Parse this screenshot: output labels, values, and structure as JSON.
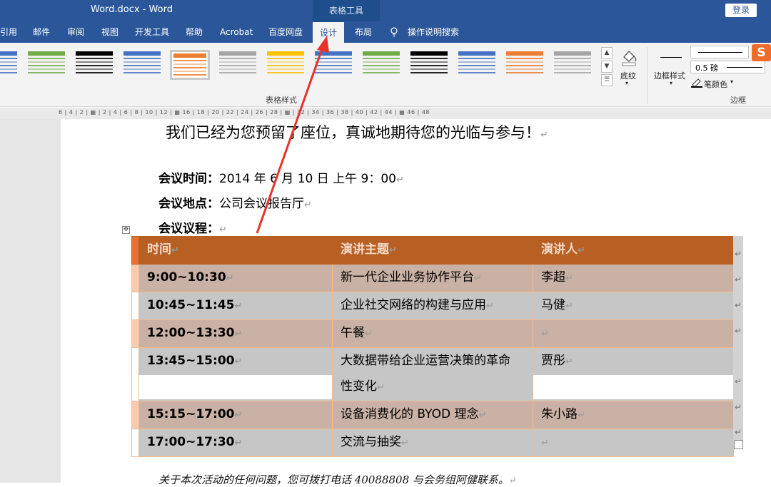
{
  "window": {
    "title": "Word.docx  -  Word",
    "context_tab": "表格工具",
    "login": "登录"
  },
  "tabs": [
    {
      "label": "引用"
    },
    {
      "label": "邮件"
    },
    {
      "label": "审阅"
    },
    {
      "label": "视图"
    },
    {
      "label": "开发工具"
    },
    {
      "label": "帮助"
    },
    {
      "label": "Acrobat"
    },
    {
      "label": "百度网盘"
    },
    {
      "label": "设计",
      "active": true
    },
    {
      "label": "布局"
    },
    {
      "label": "操作说明搜索"
    }
  ],
  "ribbon": {
    "group_table_styles": "表格样式",
    "shading": "底纹",
    "border_styles": "边框样式",
    "pen_weight": "0.5 磅",
    "pen_color": "笔颜色",
    "group_borders": "边框",
    "swatch_colors": [
      "#4472c4",
      "#70ad47",
      "#000000",
      "#4472c4",
      "#ed7d31",
      "#a5a5a5",
      "#ffc000",
      "#4472c4",
      "#70ad47",
      "#000000",
      "#4472c4",
      "#ed7d31",
      "#a5a5a5"
    ]
  },
  "ruler": {
    "text": "6 | 4 | 2 | ▦ | 2 | 4 | 6 | 8 | 10 | 12 | ▦ 16 | 18 | 20 | 22 | 24 | 26 | 28 | ▦ | 32 | 34 | 36 | 38 | 40 | 42 | 44 | ▦ 46 | 48"
  },
  "document": {
    "heading": "我们已经为您预留了座位，真诚地期待您的光临与参与！",
    "meeting_time_label": "会议时间：",
    "meeting_time_value": "2014 年 6 月 10 日  上午 9：00",
    "meeting_place_label": "会议地点：",
    "meeting_place_value": "公司会议报告厅",
    "agenda_label": "会议议程：",
    "footer": "关于本次活动的任何问题，您可拨打电话 40088808 与会务组阿健联系。",
    "para_mark": "↵"
  },
  "table": {
    "headers": [
      "时间",
      "演讲主题",
      "演讲人"
    ],
    "rows": [
      {
        "time": "9:00~10:30",
        "topic": "新一代企业业务协作平台",
        "speaker": "李超"
      },
      {
        "time": "10:45~11:45",
        "topic": "企业社交网络的构建与应用",
        "speaker": "马健"
      },
      {
        "time": "12:00~13:30",
        "topic": "午餐",
        "speaker": ""
      },
      {
        "time": "13:45~15:00",
        "topic_line1": "大数据带给企业运营决策的革命",
        "topic_line2": "性变化",
        "speaker": "贾彤"
      },
      {
        "time": "15:15~17:00",
        "topic": "设备消费化的 BYOD 理念",
        "speaker": "朱小路"
      },
      {
        "time": "17:00~17:30",
        "topic": "交流与抽奖",
        "speaker": ""
      }
    ]
  },
  "annotation": {
    "arrow_color": "#e8322b"
  }
}
